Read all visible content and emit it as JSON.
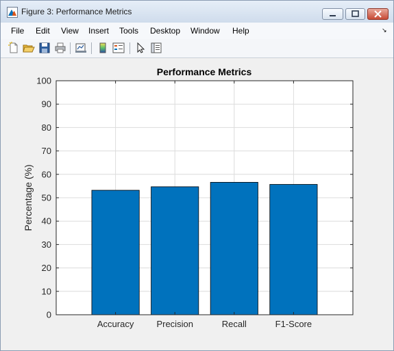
{
  "window": {
    "title": "Figure 3: Performance Metrics"
  },
  "menu": {
    "file": "File",
    "edit": "Edit",
    "view": "View",
    "insert": "Insert",
    "tools": "Tools",
    "desktop": "Desktop",
    "window": "Window",
    "help": "Help"
  },
  "toolbar_icons": [
    "new-figure-icon",
    "open-file-icon",
    "save-icon",
    "print-icon",
    "link-plot-icon",
    "colorbar-icon",
    "legend-icon",
    "select-pointer-icon",
    "property-inspector-icon"
  ],
  "colors": {
    "bar": "#0072bd",
    "grid": "#dcdcdc",
    "axes_bg": "#ffffff"
  },
  "chart_data": {
    "type": "bar",
    "title": "Performance Metrics",
    "xlabel": "",
    "ylabel": "Percentage (%)",
    "categories": [
      "Accuracy",
      "Precision",
      "Recall",
      "F1-Score"
    ],
    "values": [
      53.2,
      54.7,
      56.6,
      55.7
    ],
    "ylim": [
      0,
      100
    ],
    "yticks": [
      0,
      10,
      20,
      30,
      40,
      50,
      60,
      70,
      80,
      90,
      100
    ],
    "xlim": [
      0,
      5
    ],
    "grid": true,
    "legend": "none"
  }
}
